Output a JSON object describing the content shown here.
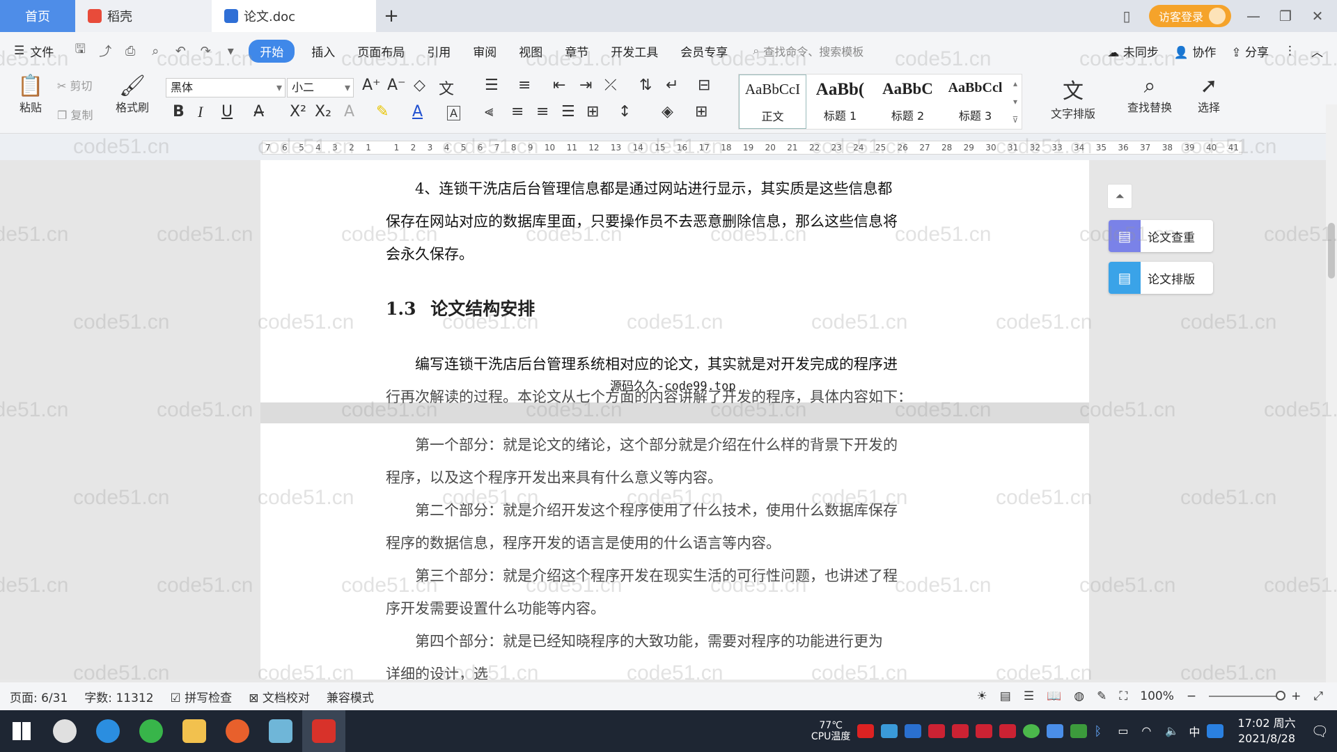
{
  "tabs": {
    "home": "首页",
    "daoke": "稻壳",
    "doc": "论文.doc",
    "login": "访客登录"
  },
  "menu": {
    "file": "文件",
    "items": [
      "开始",
      "插入",
      "页面布局",
      "引用",
      "审阅",
      "视图",
      "章节",
      "开发工具",
      "会员专享"
    ],
    "search_placeholder": "查找命令、搜索模板",
    "sync": "未同步",
    "collab": "协作",
    "share": "分享"
  },
  "ribbon": {
    "paste": "粘贴",
    "cut": "剪切",
    "copy": "复制",
    "format_painter": "格式刷",
    "font": "黑体",
    "size": "小二",
    "styles": [
      {
        "sample": "AaBbCcI",
        "label": "正文"
      },
      {
        "sample": "AaBb(",
        "label": "标题 1"
      },
      {
        "sample": "AaBbC",
        "label": "标题 2"
      },
      {
        "sample": "AaBbCcl",
        "label": "标题 3"
      }
    ],
    "text_layout": "文字排版",
    "find_replace": "查找替换",
    "select": "选择"
  },
  "ruler_ticks": [
    "7",
    "6",
    "5",
    "4",
    "3",
    "2",
    "1",
    "",
    "1",
    "2",
    "3",
    "4",
    "5",
    "6",
    "7",
    "8",
    "9",
    "10",
    "11",
    "12",
    "13",
    "14",
    "15",
    "16",
    "17",
    "18",
    "19",
    "20",
    "21",
    "22",
    "23",
    "24",
    "25",
    "26",
    "27",
    "28",
    "29",
    "30",
    "31",
    "32",
    "33",
    "34",
    "35",
    "36",
    "37",
    "38",
    "39",
    "40",
    "41"
  ],
  "document": {
    "para_4_line1": "4、连锁干洗店后台管理信息都是通过网站进行显示，其实质是这些信息都",
    "para_4_line2": "保存在网站对应的数据库里面，只要操作员不去恶意删除信息，那么这些信息将",
    "para_4_line3": "会永久保存。",
    "heading_num": "1.3",
    "heading_text": "论文结构安排",
    "intro_line1": "编写连锁干洗店后台管理系统相对应的论文，其实就是对开发完成的程序进",
    "intro_line2": "行再次解读的过程。本论文从七个方面的内容讲解了开发的程序，具体内容如下：",
    "overlay_watermark": "源码久久-code99.top",
    "p1_line1": "第一个部分：就是论文的绪论，这个部分就是介绍在什么样的背景下开发的",
    "p1_line2": "程序，以及这个程序开发出来具有什么意义等内容。",
    "p2_line1": "第二个部分：就是介绍开发这个程序使用了什么技术，使用什么数据库保存",
    "p2_line2": "程序的数据信息，程序开发的语言是使用的什么语言等内容。",
    "p3_line1": "第三个部分：就是介绍这个程序开发在现实生活的可行性问题，也讲述了程",
    "p3_line2": "序开发需要设置什么功能等内容。",
    "p4_line1": "第四个部分：就是已经知晓程序的大致功能，需要对程序的功能进行更为",
    "p4_line2": "详细的设计，选"
  },
  "side_panel": {
    "check": "论文查重",
    "layout": "论文排版"
  },
  "status": {
    "page": "页面: 6/31",
    "words": "字数: 11312",
    "spell": "拼写检查",
    "proof": "文档校对",
    "compat": "兼容模式",
    "zoom": "100%"
  },
  "taskbar": {
    "temp": "77℃",
    "cpu_label": "CPU温度",
    "ime": "中",
    "time": "17:02 周六",
    "date": "2021/8/28"
  },
  "watermark_text": "code51.cn",
  "colors": {
    "accent": "#3f88e9",
    "home_tab": "#4e8de8",
    "login": "#f5a32a",
    "check_icon": "#7a82e8",
    "layout_icon": "#3aa3e8"
  }
}
